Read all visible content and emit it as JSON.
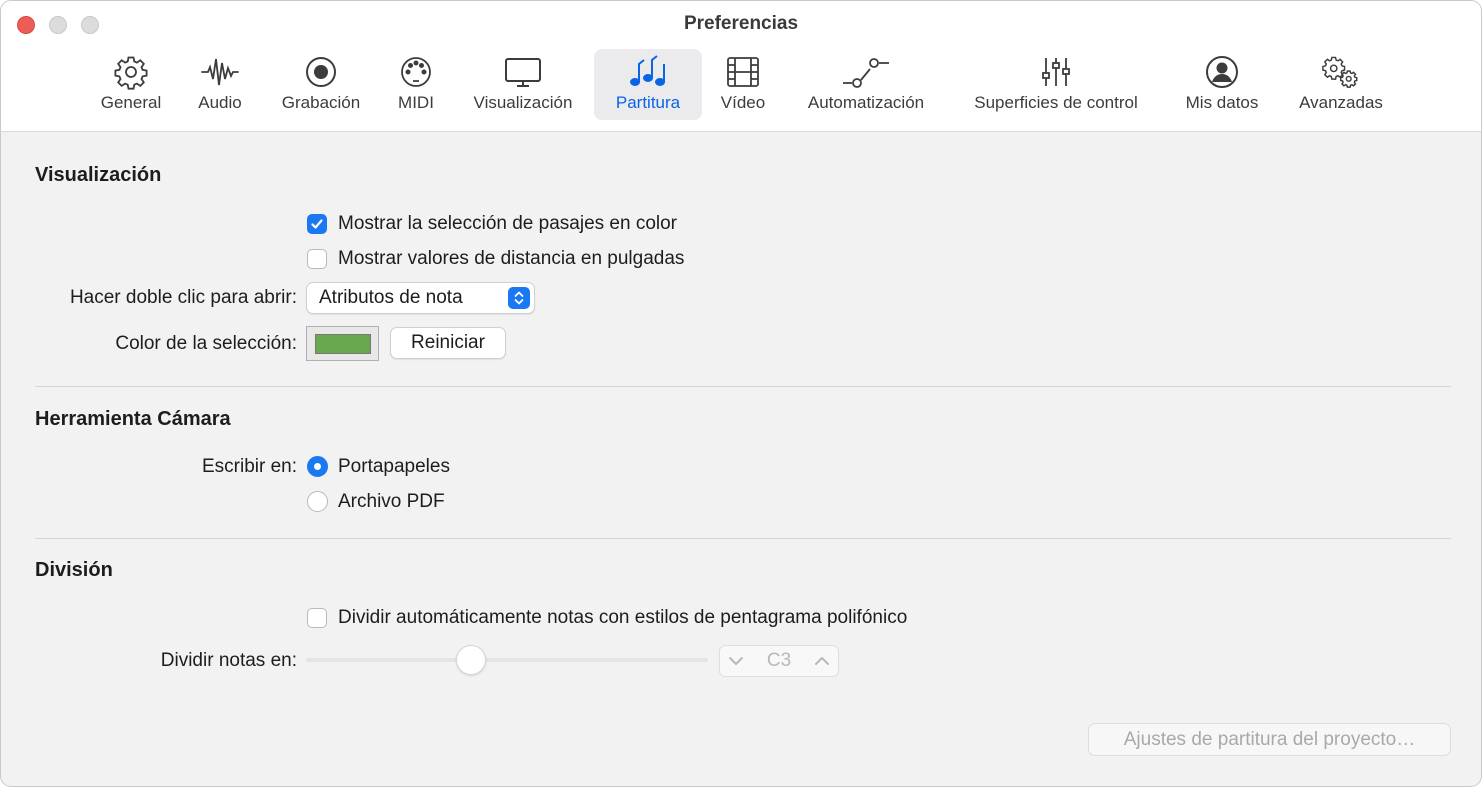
{
  "window": {
    "title": "Preferencias"
  },
  "toolbar": {
    "tabs": [
      {
        "label": "General",
        "icon": "gear-icon"
      },
      {
        "label": "Audio",
        "icon": "waveform-icon"
      },
      {
        "label": "Grabación",
        "icon": "record-icon"
      },
      {
        "label": "MIDI",
        "icon": "midi-port-icon"
      },
      {
        "label": "Visualización",
        "icon": "display-icon"
      },
      {
        "label": "Partitura",
        "icon": "music-notes-icon",
        "active": true
      },
      {
        "label": "Vídeo",
        "icon": "film-icon"
      },
      {
        "label": "Automatización",
        "icon": "automation-curve-icon"
      },
      {
        "label": "Superficies de control",
        "icon": "sliders-icon"
      },
      {
        "label": "Mis datos",
        "icon": "person-icon"
      },
      {
        "label": "Avanzadas",
        "icon": "gears-icon"
      }
    ]
  },
  "display": {
    "heading": "Visualización",
    "show_selection_color": {
      "label": "Mostrar la selección de pasajes en color",
      "checked": true
    },
    "show_distance_inches": {
      "label": "Mostrar valores de distancia en pulgadas",
      "checked": false
    },
    "double_click_label": "Hacer doble clic para abrir:",
    "double_click_value": "Atributos de nota",
    "selection_color_label": "Color de la selección:",
    "selection_color": "#6aa84f",
    "reset_label": "Reiniciar"
  },
  "camera": {
    "heading": "Herramienta Cámara",
    "write_to_label": "Escribir en:",
    "options": [
      {
        "label": "Portapapeles",
        "selected": true
      },
      {
        "label": "Archivo PDF",
        "selected": false
      }
    ]
  },
  "split": {
    "heading": "División",
    "auto_split": {
      "label": "Dividir automáticamente notas con estilos de pentagrama polifónico",
      "checked": false
    },
    "split_notes_label": "Dividir notas en:",
    "split_value": "C3",
    "slider_fraction": 0.41
  },
  "footer": {
    "project_settings_label": "Ajustes de partitura del proyecto…"
  },
  "colors": {
    "accent": "#1a78f2",
    "active_tab_text": "#0a64e6",
    "close_button": "#ee5c57"
  }
}
